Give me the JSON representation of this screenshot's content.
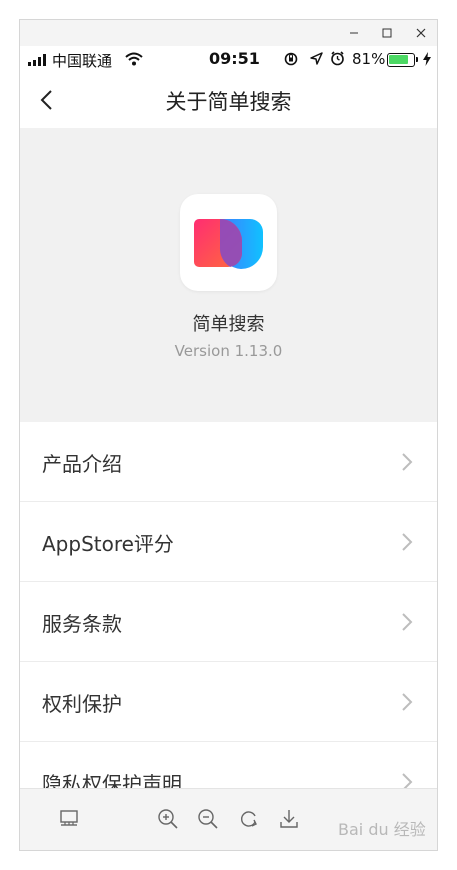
{
  "status": {
    "carrier": "中国联通",
    "time": "09:51",
    "battery": "81%",
    "battery_level": 0.81,
    "icons": [
      "signal-icon",
      "wifi-icon",
      "orientation-lock-icon",
      "location-arrow-icon",
      "alarm-icon",
      "battery-icon",
      "charging-icon"
    ]
  },
  "nav": {
    "title": "关于简单搜索"
  },
  "app": {
    "name": "简单搜索",
    "version": "Version 1.13.0"
  },
  "menu": {
    "items": [
      {
        "label": "产品介绍"
      },
      {
        "label": "AppStore评分"
      },
      {
        "label": "服务条款"
      },
      {
        "label": "权利保护"
      },
      {
        "label": "隐私权保护声明"
      }
    ]
  },
  "toolbar": {
    "icons": [
      "thumbnail-icon",
      "zoom-in-icon",
      "zoom-out-icon",
      "rotate-icon",
      "download-icon"
    ]
  },
  "watermark": {
    "text": "Bai du 经验"
  },
  "colors": {
    "battery_green": "#4cd964",
    "logo_pink": "#ff3a6e",
    "logo_blue": "#1aa0ff",
    "logo_purple": "#8a4cc0"
  }
}
